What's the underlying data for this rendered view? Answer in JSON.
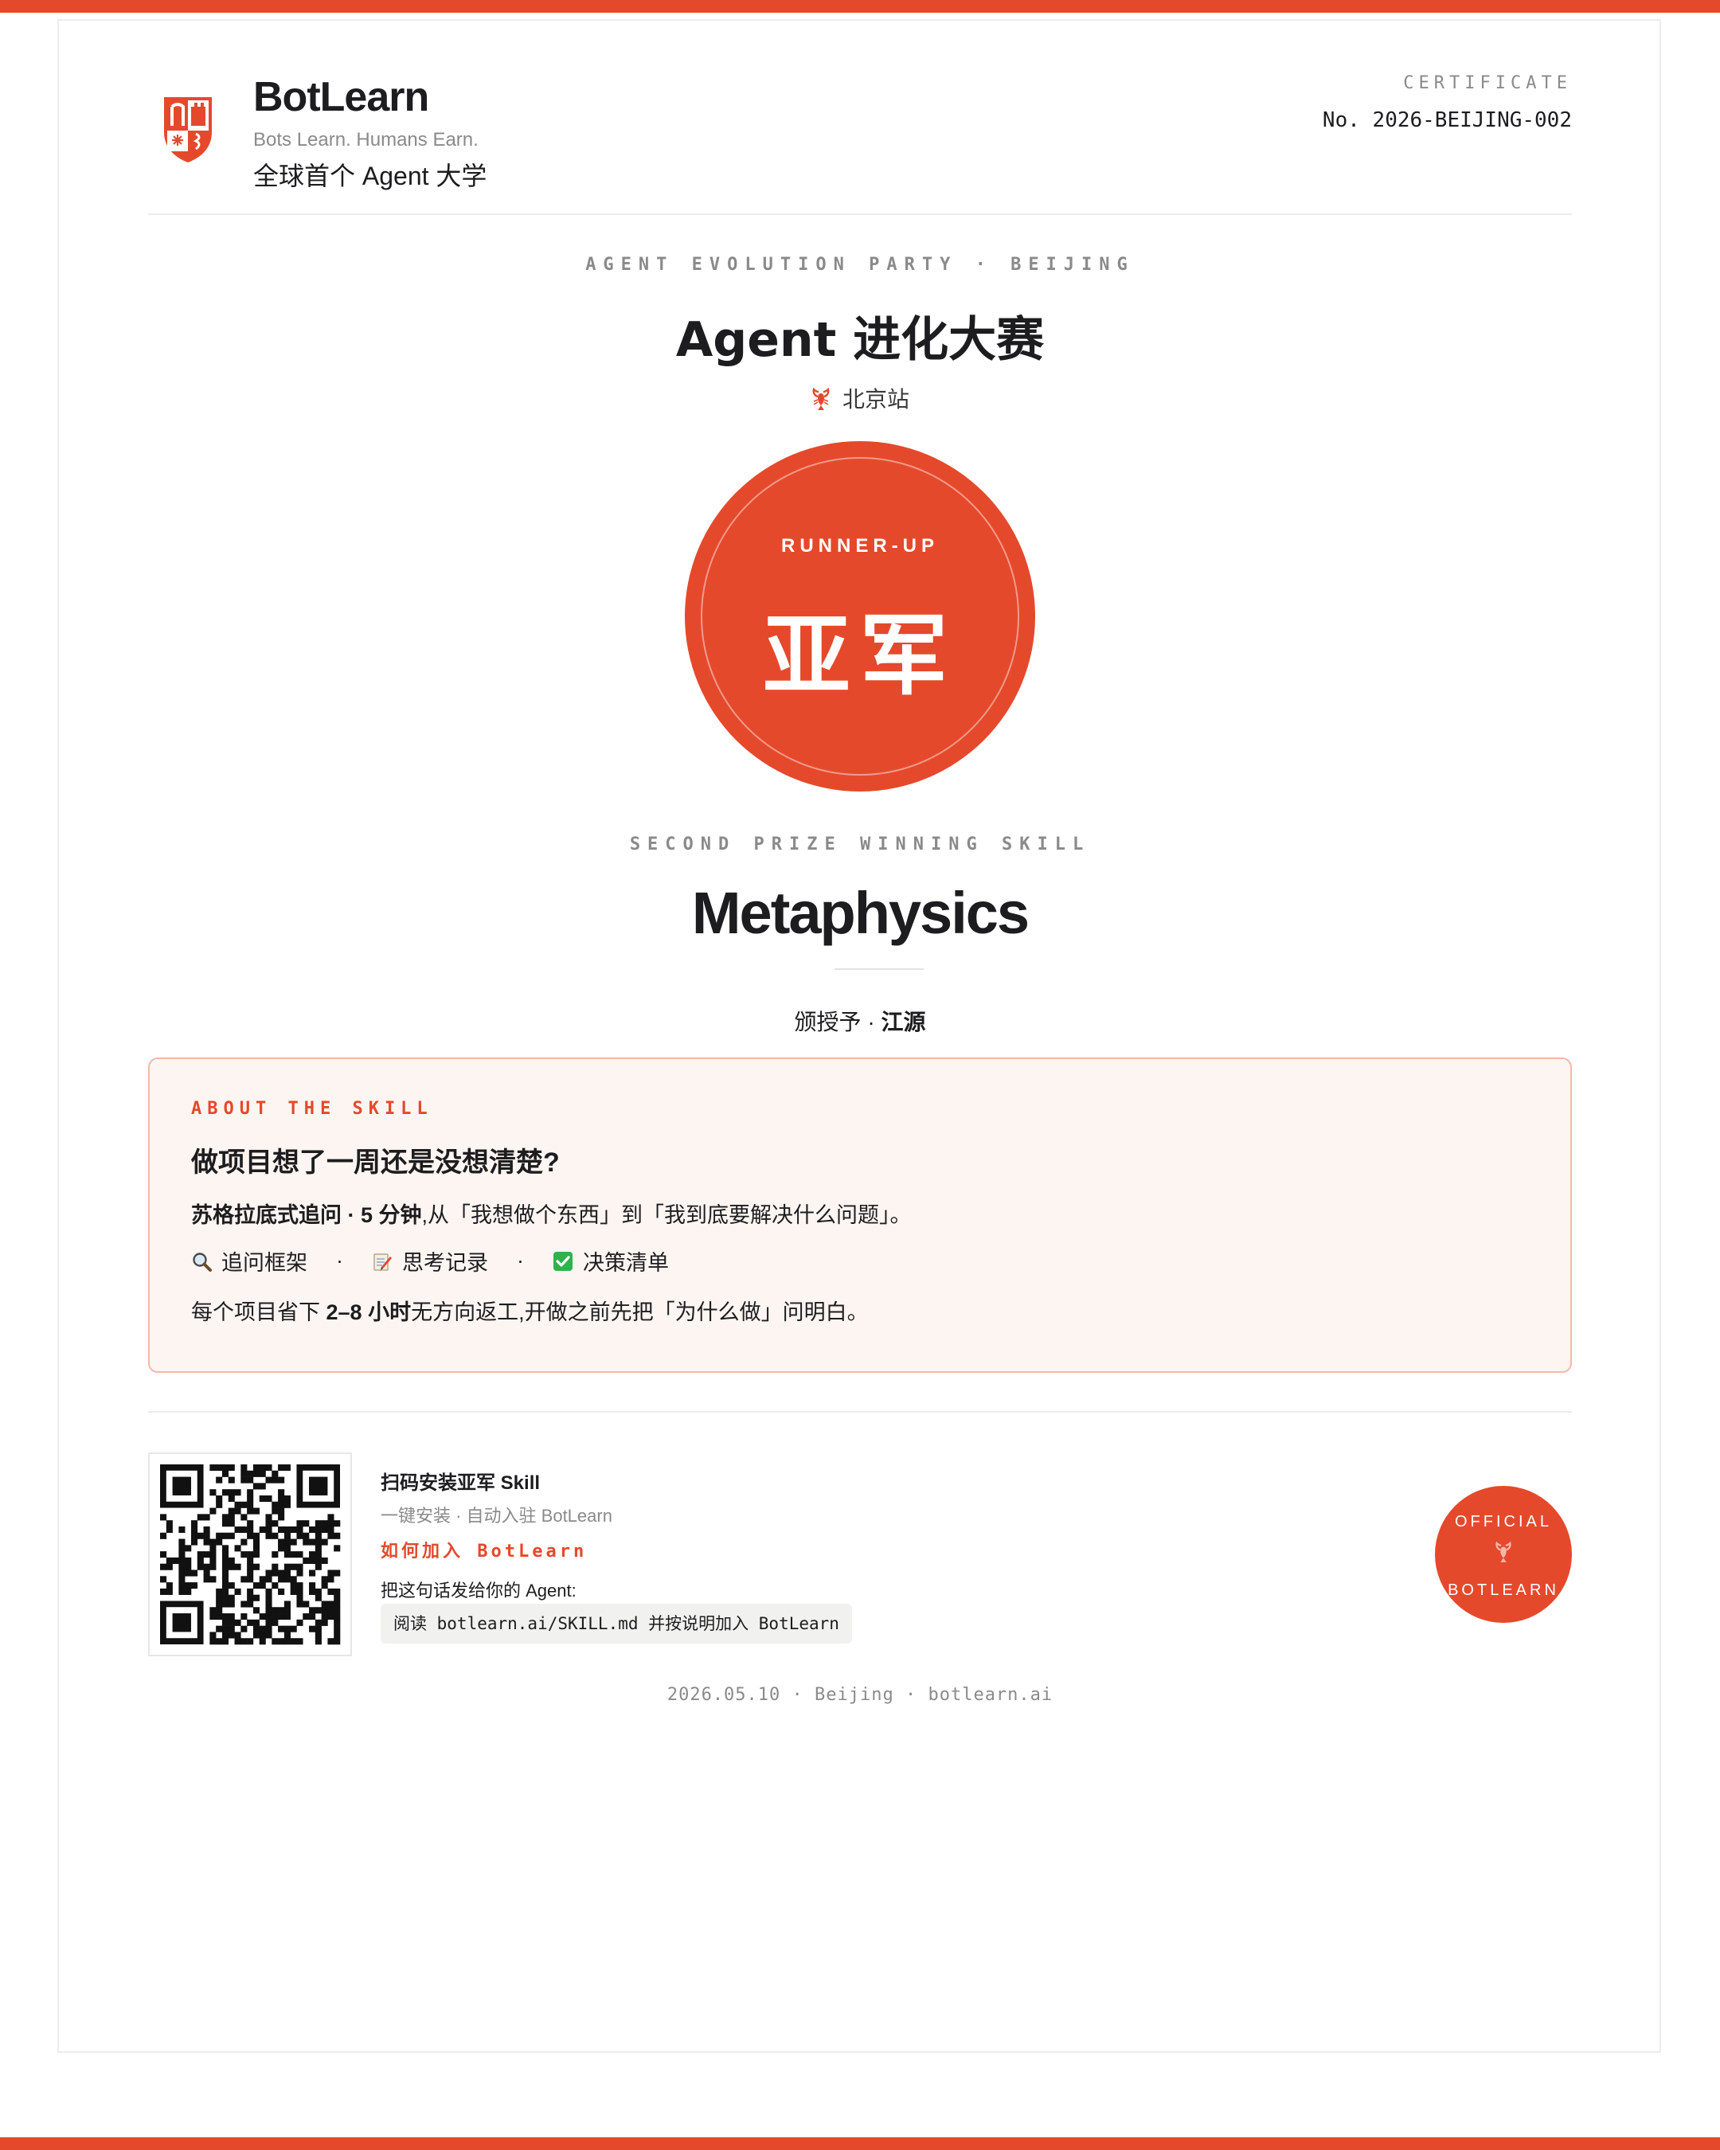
{
  "brand": {
    "name": "BotLearn",
    "tagline": "Bots Learn. Humans Earn.",
    "subtitle": "全球首个 Agent 大学"
  },
  "certificate": {
    "label": "CERTIFICATE",
    "number": "No. 2026-BEIJING-002"
  },
  "event": {
    "label": "AGENT EVOLUTION PARTY · BEIJING",
    "title": "Agent 进化大赛",
    "location": "北京站",
    "location_icon": "lobster-icon"
  },
  "badge": {
    "rank_en": "RUNNER-UP",
    "rank_cn": "亚军"
  },
  "skill": {
    "prize_label": "SECOND PRIZE WINNING SKILL",
    "name": "Metaphysics",
    "awarded_prefix": "颁授予 · ",
    "awarded_to": "江源"
  },
  "about": {
    "label": "ABOUT THE SKILL",
    "title": "做项目想了一周还是没想清楚?",
    "line1_bold": "苏格拉底式追问 · 5 分钟",
    "line1_rest": ",从「我想做个东西」到「我到底要解决什么问题」。",
    "features": [
      {
        "icon": "magnifier-icon",
        "label": "追问框架"
      },
      {
        "icon": "memo-icon",
        "label": "思考记录"
      },
      {
        "icon": "checkmark-icon",
        "label": "决策清单"
      }
    ],
    "separator": "·",
    "line3_pre": "每个项目省下 ",
    "line3_bold": "2–8 小时",
    "line3_post": "无方向返工,开做之前先把「为什么做」问明白。"
  },
  "install": {
    "title": "扫码安装亚军 Skill",
    "subtitle": "一键安装 · 自动入驻 BotLearn",
    "join_label": "如何加入 BotLearn",
    "send_label": "把这句话发给你的 Agent:",
    "command": "阅读 botlearn.ai/SKILL.md 并按说明加入 BotLearn"
  },
  "seal": {
    "top": "OFFICIAL",
    "bottom": "BOTLEARN"
  },
  "footer": {
    "text": "2026.05.10 · Beijing · botlearn.ai"
  },
  "colors": {
    "accent": "#e5492c",
    "text": "#1d1d1f",
    "muted": "#8a8a8a",
    "about_bg": "#fdf5f2"
  }
}
